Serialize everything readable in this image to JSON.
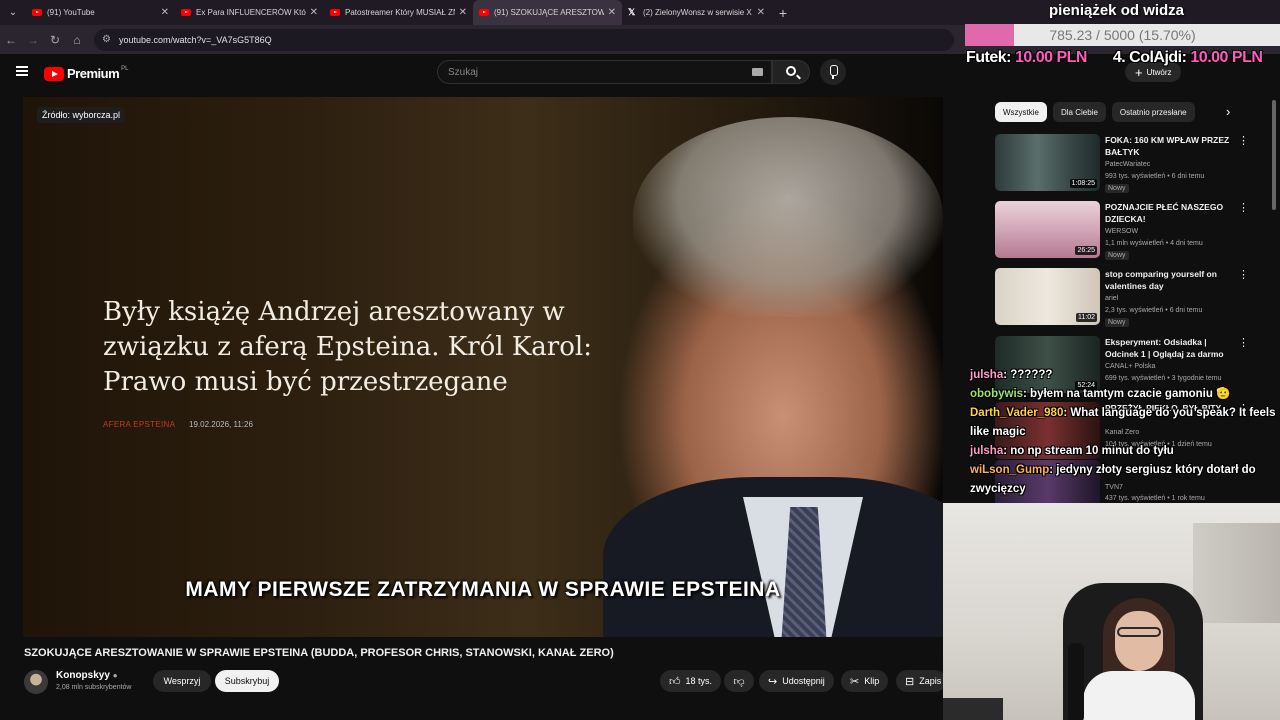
{
  "browser": {
    "tabs": [
      {
        "label": "(91) YouTube",
        "icon": "youtube-icon",
        "active": false
      },
      {
        "label": "Ex Para INFLUENCERÓW Która",
        "icon": "youtube-icon",
        "active": false
      },
      {
        "label": "Patostreamer Który MUSIAŁ ZN",
        "icon": "youtube-icon",
        "active": false
      },
      {
        "label": "(91) SZOKUJĄCE ARESZTOWAN",
        "icon": "youtube-icon",
        "active": true
      },
      {
        "label": "(2) ZielonyWonsz w serwisie X",
        "icon": "x-icon",
        "active": false
      }
    ],
    "url": "youtube.com/watch?v=_VA7sG5T86Q"
  },
  "youtube": {
    "logo_label": "Premium",
    "logo_country": "PL",
    "search_placeholder": "Szukaj",
    "create_label": "Utwórz"
  },
  "video": {
    "source_badge": "Źródło: wyborcza.pl",
    "headline": "Były książę Andrzej aresztowany w związku z aferą Epsteina. Król Karol: Prawo musi być przestrzegane",
    "tag": "AFERA EPSTEINA",
    "date": "19.02.2026, 11:26",
    "subtitle": "MAMY PIERWSZE ZATRZYMANIA W SPRAWIE EPSTEINA",
    "title": "SZOKUJĄCE ARESZTOWANIE W SPRAWIE EPSTEINA (BUDDA, PROFESOR CHRIS, STANOWSKI, KANAŁ ZERO)",
    "channel": "Konopskyy",
    "subscribers": "2,08 mln subskrybentów",
    "support_label": "Wesprzyj",
    "subscribe_label": "Subskrybuj",
    "likes": "18 tys.",
    "share_label": "Udostępnij",
    "clip_label": "Klip",
    "save_label": "Zapis"
  },
  "sidebar": {
    "chips": [
      "Wszystkie",
      "Dla Ciebie",
      "Ostatnio przesłane"
    ],
    "items": [
      {
        "title": "FOKA: 160 KM WPŁAW PRZEZ BAŁTYK",
        "channel": "PatecWariatec",
        "stats": "993 tys. wyświetleń • 6 dni temu",
        "badge": "Nowy",
        "duration": "1:08:25"
      },
      {
        "title": "POZNAJCIE PŁEĆ NASZEGO DZIECKA!",
        "channel": "WERSOW",
        "stats": "1,1 mln wyświetleń • 4 dni temu",
        "badge": "Nowy",
        "duration": "26:25"
      },
      {
        "title": "stop comparing yourself on valentines day",
        "channel": "ariel",
        "stats": "2,3 tys. wyświetleń • 6 dni temu",
        "badge": "Nowy",
        "duration": "11:02"
      },
      {
        "title": "Eksperyment: Odsiadka | Odcinek 1 | Oglądaj za darmo",
        "channel": "CANAL+ Polska",
        "stats": "699 tys. wyświetleń • 3 tygodnie temu",
        "duration": "52:24"
      },
      {
        "title": "PRZEŻYŁ PIEKŁO, BYŁ BITY,",
        "channel": "Kanał Zero",
        "stats": "104 tys. wyświetleń • 1 dzień temu"
      },
      {
        "title": "",
        "channel": "TVN7",
        "stats": "437 tys. wyświetleń • 1 rok temu"
      }
    ]
  },
  "overlay": {
    "donation_title": "pieniążek od widza",
    "donation_progress": "785.23 / 5000 (15.70%)",
    "donation_fraction": 0.157,
    "ticker": [
      {
        "name": "Futek:",
        "amount": "10.00 PLN"
      },
      {
        "name": "4. ColAjdi:",
        "amount": "10.00 PLN"
      }
    ],
    "chat": [
      {
        "user": "julsha",
        "text": ": ??????",
        "color": "#ff9ec8"
      },
      {
        "user": "obobywis",
        "text": ": byłem na tamtym czacie gamoniu 🫡",
        "color": "#9be36b"
      },
      {
        "user": "Darth_Vader_980",
        "text": ": What language do you speak? It feels like magic",
        "color": "#ffd24d"
      },
      {
        "user": "julsha",
        "text": ": no np stream 10 minut do tyłu",
        "color": "#ff9ec8"
      },
      {
        "user": "wiLson_Gump",
        "text": ": jedyny złoty sergiusz który dotarł do zwycięzcy",
        "color": "#ffb347"
      }
    ]
  }
}
